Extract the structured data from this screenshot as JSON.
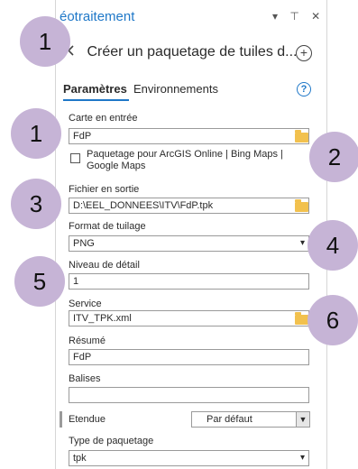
{
  "pane": {
    "title": "éotraitement",
    "controls": "▾ ⊤ ✕",
    "tool_name": "Créer un paquetage de tuiles d...",
    "tabs": [
      "Paramètres",
      "Environnements"
    ],
    "help": "?"
  },
  "form": {
    "input_map_label": "Carte en entrée",
    "input_map_value": "FdP",
    "checkbox_label": "Paquetage pour ArcGIS Online | Bing Maps | Google Maps",
    "output_file_label": "Fichier en sortie",
    "output_file_value": "D:\\EEL_DONNEES\\ITV\\FdP.tpk",
    "tiling_format_label": "Format de tuilage",
    "tiling_format_value": "PNG",
    "level_label": "Niveau de détail",
    "level_value": "1",
    "service_label": "Service",
    "service_value": "ITV_TPK.xml",
    "summary_label": "Résumé",
    "summary_value": "FdP",
    "tags_label": "Balises",
    "tags_value": "",
    "extent_label": "Etendue",
    "extent_value": "Par défaut",
    "package_type_label": "Type de paquetage",
    "package_type_value": "tpk"
  },
  "badges": [
    "1",
    "1",
    "2",
    "3",
    "4",
    "5",
    "6"
  ],
  "colors": {
    "accent": "#1f78c8",
    "badge": "#c6b4d6",
    "folder": "#f2c14e"
  }
}
